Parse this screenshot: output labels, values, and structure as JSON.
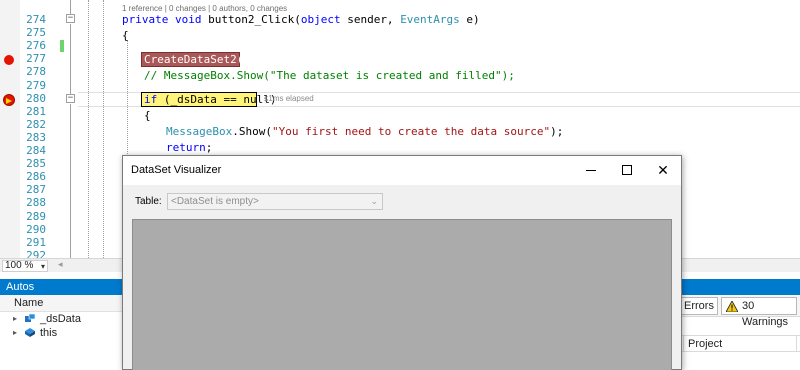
{
  "editor": {
    "codelens": "1 reference | 0 changes | 0 authors, 0 changes",
    "line_numbers": [
      "274",
      "275",
      "276",
      "277",
      "278",
      "279",
      "280",
      "281",
      "282",
      "283",
      "284",
      "285",
      "286",
      "287",
      "288",
      "289",
      "290",
      "291",
      "292"
    ],
    "lines": {
      "l274_kw1": "private",
      "l274_kw2": "void",
      "l274_name": " button2_Click(",
      "l274_kw3": "object",
      "l274_mid": " sender, ",
      "l274_type": "EventArgs",
      "l274_end": " e)",
      "l275": "{",
      "l277": "CreateDataSet2();",
      "l278": "// MessageBox.Show(\"The dataset is created and filled\");",
      "l280_kw": "if",
      "l280_rest": " (_dsData == null)",
      "l281": "{",
      "l282_type": "MessageBox",
      "l282_mid": ".Show(",
      "l282_str": "\"You first need to create the data source\"",
      "l282_end": ");",
      "l283_kw": "return",
      "l283_end": ";",
      "l284": "}"
    },
    "elapsed": "≤1ms elapsed",
    "breakpoint_icon": "breakpoint-icon",
    "current_statement_icon": "current-statement-arrow-icon",
    "breakpoint_color": "#e51400",
    "current_line_color": "#fff57a"
  },
  "zoombar": {
    "zoom": "100 %",
    "zoom_arrow": "▾",
    "scroll_left": "◂"
  },
  "autos": {
    "title": "Autos",
    "column_name": "Name",
    "rows": [
      {
        "name": "_dsData",
        "expander": "▸",
        "icon": "dataset-object-icon"
      },
      {
        "name": "this",
        "expander": "▸",
        "icon": "object-icon"
      }
    ],
    "title_color": "#007acc"
  },
  "error_list": {
    "errors_label": "Errors",
    "warnings_label": "30 Warnings",
    "project_column": "Project"
  },
  "dialog": {
    "title": "DataSet Visualizer",
    "minimize": "—",
    "maximize": "□",
    "close": "✕",
    "table_label": "Table:",
    "table_value": "<DataSet is empty>",
    "table_arrow": "⌄"
  }
}
